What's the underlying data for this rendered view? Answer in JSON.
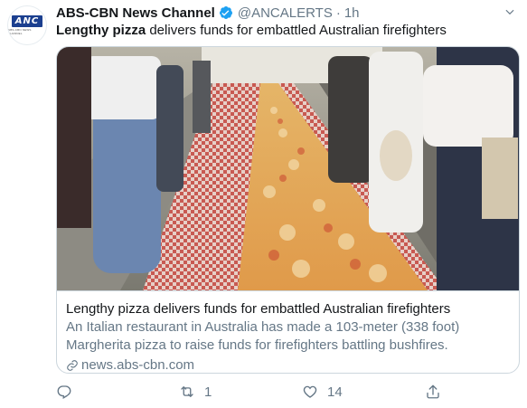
{
  "avatar": {
    "logo_text": "ANC",
    "sub_text": "ABS-CBN NEWS CHANNEL"
  },
  "header": {
    "name": "ABS-CBN News Channel",
    "handle": "@ANCALERTS",
    "separator": "·",
    "time": "1h"
  },
  "tweet": {
    "bold_text": "Lengthy pizza",
    "rest_text": " delivers funds for embattled Australian firefighters"
  },
  "card": {
    "title": "Lengthy pizza delivers funds for embattled Australian firefighters",
    "description": "An Italian restaurant in Australia has made a 103-meter (338 foot) Margherita pizza to raise funds for firefighters battling bushfires.",
    "domain": "news.abs-cbn.com"
  },
  "actions": {
    "reply_count": "",
    "retweet_count": "1",
    "like_count": "14"
  },
  "colors": {
    "text": "#14171a",
    "secondary": "#657786",
    "border": "#ccd6dd",
    "verified": "#1da1f2"
  },
  "icons": [
    "verified-badge-icon",
    "chevron-down-icon",
    "link-icon",
    "reply-icon",
    "retweet-icon",
    "like-icon",
    "share-icon"
  ]
}
